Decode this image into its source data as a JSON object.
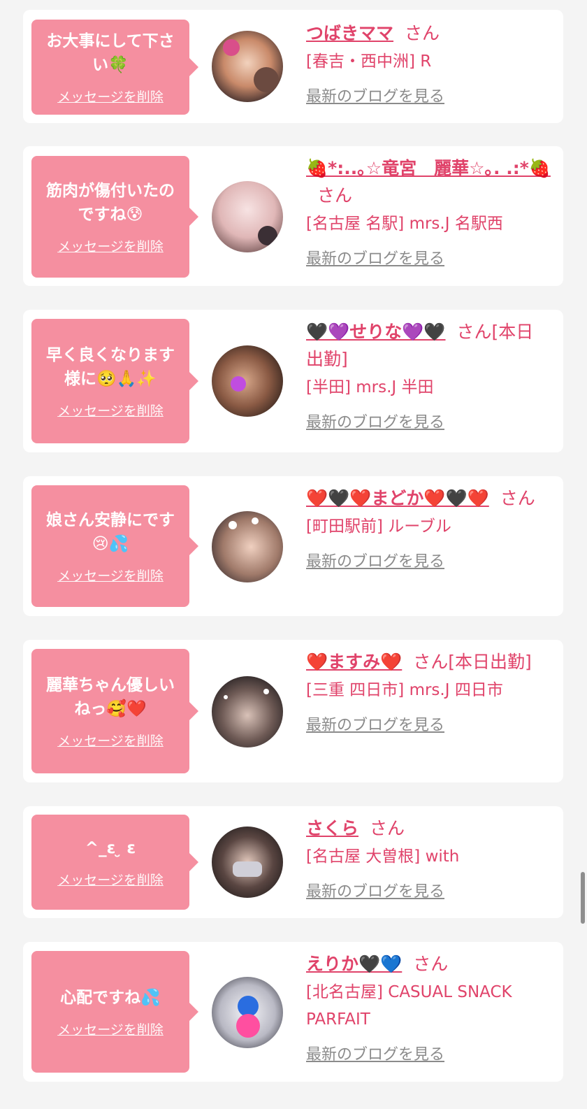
{
  "delete_label": "メッセージを削除",
  "blog_label": "最新のブログを見る",
  "san_label": "さん",
  "colors": {
    "accent": "#e0436a",
    "bubble": "#f58fa0",
    "link": "#8b8b8b"
  },
  "items": [
    {
      "message": "お大事にして下さい🍀",
      "name": "つばきママ",
      "san": "さん",
      "shop": "[春吉・西中洲] R"
    },
    {
      "message": "筋肉が傷付いたのですね😰",
      "name": "🍓*:..｡☆竜宮　麗華☆｡. .:*🍓",
      "san": "さん",
      "shop": "[名古屋 名駅] mrs.J 名駅西"
    },
    {
      "message": "早く良くなります様に🥺🙏✨",
      "name": "🖤💜せりな💜🖤",
      "san": "さん[本日出勤]",
      "shop": "[半田] mrs.J 半田"
    },
    {
      "message": "娘さん安静にです😢💦",
      "name": "❤️🖤❤️まどか❤️🖤❤️",
      "san": "さん",
      "shop": "[町田駅前] ルーブル"
    },
    {
      "message": "麗華ちゃん優しいねっ🥰❤️",
      "name": "❤️ますみ❤️",
      "san": "さん[本日出勤]",
      "shop": "[三重 四日市] mrs.J 四日市"
    },
    {
      "message": "^_ε ̮ ε",
      "name": "さくら",
      "san": "さん",
      "shop": "[名古屋 大曽根] with"
    },
    {
      "message": "心配ですね💦",
      "name": "えりか🖤💙",
      "san": "さん",
      "shop": "[北名古屋] CASUAL SNACK PARFAIT"
    }
  ]
}
